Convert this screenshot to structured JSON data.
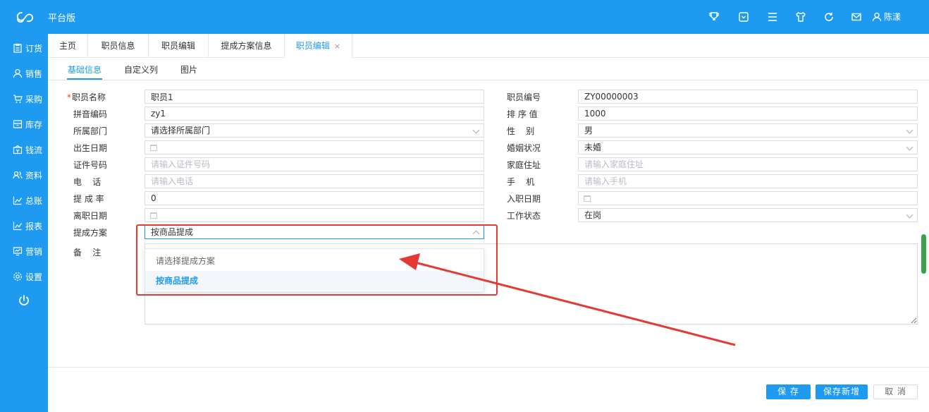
{
  "app": {
    "title": "平台版",
    "user_name": "陈漾"
  },
  "header_icons": [
    "trophy-icon",
    "square-chevron-icon",
    "menu-icon",
    "shirt-icon",
    "refresh-icon",
    "mail-icon"
  ],
  "sidebar": {
    "items": [
      {
        "label": "订货",
        "icon": "clipboard-icon"
      },
      {
        "label": "销售",
        "icon": "user-icon"
      },
      {
        "label": "采购",
        "icon": "cart-icon"
      },
      {
        "label": "库存",
        "icon": "box-icon"
      },
      {
        "label": "钱流",
        "icon": "money-icon"
      },
      {
        "label": "资料",
        "icon": "users-icon"
      },
      {
        "label": "总账",
        "icon": "chart-icon"
      },
      {
        "label": "报表",
        "icon": "chart-icon"
      },
      {
        "label": "营销",
        "icon": "monitor-icon"
      },
      {
        "label": "设置",
        "icon": "gear-icon"
      }
    ],
    "power_icon": "power-icon"
  },
  "tabs": [
    {
      "label": "主页"
    },
    {
      "label": "职员信息"
    },
    {
      "label": "职员编辑"
    },
    {
      "label": "提成方案信息"
    },
    {
      "label": "职员编辑",
      "close": "×"
    }
  ],
  "subtabs": [
    "基础信息",
    "自定义列",
    "图片"
  ],
  "form": {
    "required_mark": "*",
    "left": {
      "name": {
        "label": "职员名称",
        "value": "职员1"
      },
      "pinyin": {
        "label": "拼音编码",
        "value": "zy1"
      },
      "dept": {
        "label": "所属部门",
        "value": "请选择所属部门"
      },
      "birth": {
        "label": "出生日期",
        "value": ""
      },
      "id_no": {
        "label": "证件号码",
        "placeholder": "请输入证件号码"
      },
      "phone": {
        "label": "电    话",
        "placeholder": "请输入电话"
      },
      "commission_rate": {
        "label": "提 成 率",
        "value": "0"
      },
      "leave_date": {
        "label": "离职日期",
        "value": ""
      },
      "plan": {
        "label": "提成方案",
        "value": "按商品提成"
      },
      "notes": {
        "label": "备    注",
        "value": ""
      }
    },
    "right": {
      "code": {
        "label": "职员编号",
        "value": "ZY00000003"
      },
      "sort": {
        "label": "排 序 值",
        "value": "1000"
      },
      "gender": {
        "label": "性    别",
        "value": "男"
      },
      "marital": {
        "label": "婚姻状况",
        "value": "未婚"
      },
      "address": {
        "label": "家庭住址",
        "placeholder": "请输入家庭住址"
      },
      "mobile": {
        "label": "手    机",
        "placeholder": "请输入手机"
      },
      "hire_date": {
        "label": "入职日期",
        "value": ""
      },
      "status": {
        "label": "工作状态",
        "value": "在岗"
      }
    }
  },
  "plan_dropdown": {
    "options": [
      "请选择提成方案",
      "按商品提成"
    ],
    "selected": "按商品提成"
  },
  "footer": {
    "save": "保 存",
    "save_new": "保存新增",
    "cancel": "取 消"
  },
  "colors": {
    "brand": "#1e9bf0",
    "highlight": "#e53935"
  }
}
